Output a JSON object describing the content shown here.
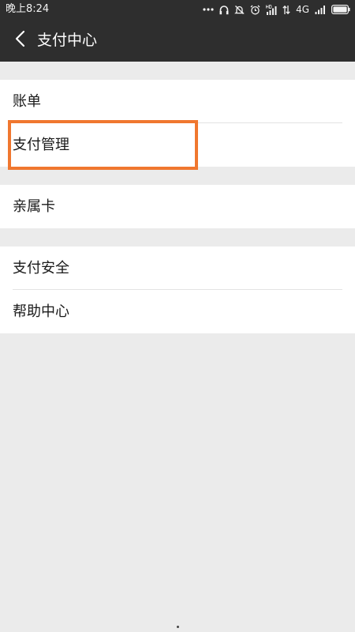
{
  "status_bar": {
    "time": "晚上8:24",
    "network": "4G",
    "icons": [
      "more-dots-icon",
      "headphones-icon",
      "mute-icon",
      "alarm-icon",
      "hd-signal-icon",
      "data-arrows-icon",
      "signal-icon",
      "battery-icon"
    ]
  },
  "header": {
    "back_icon": "chevron-left-icon",
    "title": "支付中心"
  },
  "menu": {
    "group1": [
      {
        "label": "账单"
      },
      {
        "label": "支付管理"
      }
    ],
    "group2": [
      {
        "label": "亲属卡"
      }
    ],
    "group3": [
      {
        "label": "支付安全"
      },
      {
        "label": "帮助中心"
      }
    ]
  },
  "colors": {
    "bar_background": "#2e2e2e",
    "page_background": "#ebebeb",
    "highlight": "#f0772f"
  }
}
